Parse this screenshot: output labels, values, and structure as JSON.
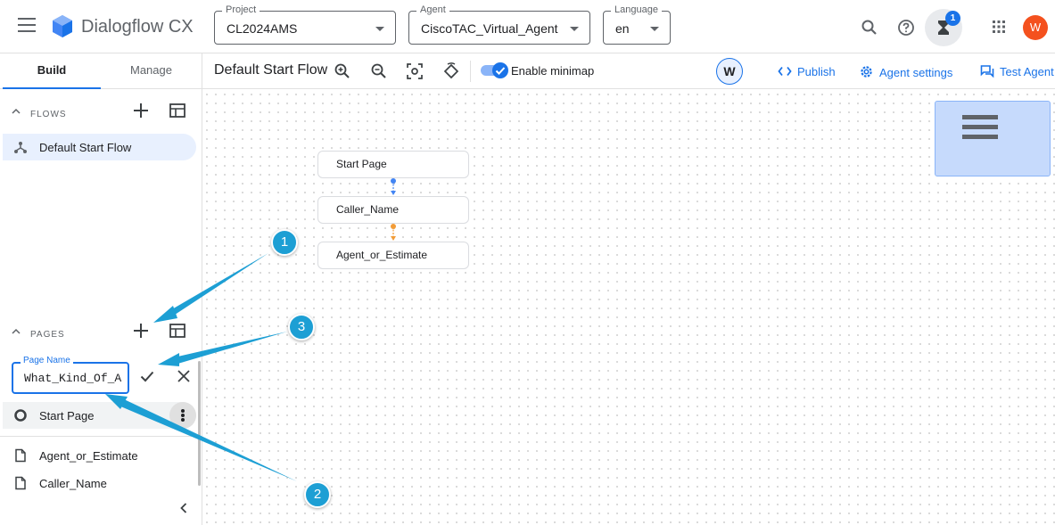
{
  "header": {
    "app_title": "Dialogflow CX",
    "project": {
      "label": "Project",
      "value": "CL2024AMS"
    },
    "agent": {
      "label": "Agent",
      "value": "CiscoTAC_Virtual_Agent"
    },
    "language": {
      "label": "Language",
      "value": "en"
    },
    "tasks_badge": "1",
    "avatar_initial": "W"
  },
  "tabs": {
    "build": "Build",
    "manage": "Manage"
  },
  "flow_toolbar": {
    "title": "Default Start Flow",
    "minimap_label": "Enable minimap",
    "minimap_enabled": true,
    "user_badge": "W",
    "publish": "Publish",
    "agent_settings": "Agent settings",
    "test_agent": "Test Agent"
  },
  "sidebar": {
    "flows_title": "FLOWS",
    "flows": [
      {
        "label": "Default Start Flow"
      }
    ],
    "pages_title": "PAGES",
    "page_name_field": {
      "label": "Page Name",
      "value": "What_Kind_Of_A"
    },
    "pages": [
      {
        "label": "Start Page"
      },
      {
        "label": "Agent_or_Estimate"
      },
      {
        "label": "Caller_Name"
      }
    ]
  },
  "canvas": {
    "nodes": [
      {
        "label": "Start Page"
      },
      {
        "label": "Caller_Name"
      },
      {
        "label": "Agent_or_Estimate"
      }
    ]
  },
  "annotations": {
    "callout_1": "1",
    "callout_2": "2",
    "callout_3": "3"
  },
  "colors": {
    "accent": "#1a73e8",
    "callout": "#1d9fd4",
    "avatar": "#f4511e",
    "link_blue": "#4285f4",
    "link_orange": "#f29c38"
  }
}
